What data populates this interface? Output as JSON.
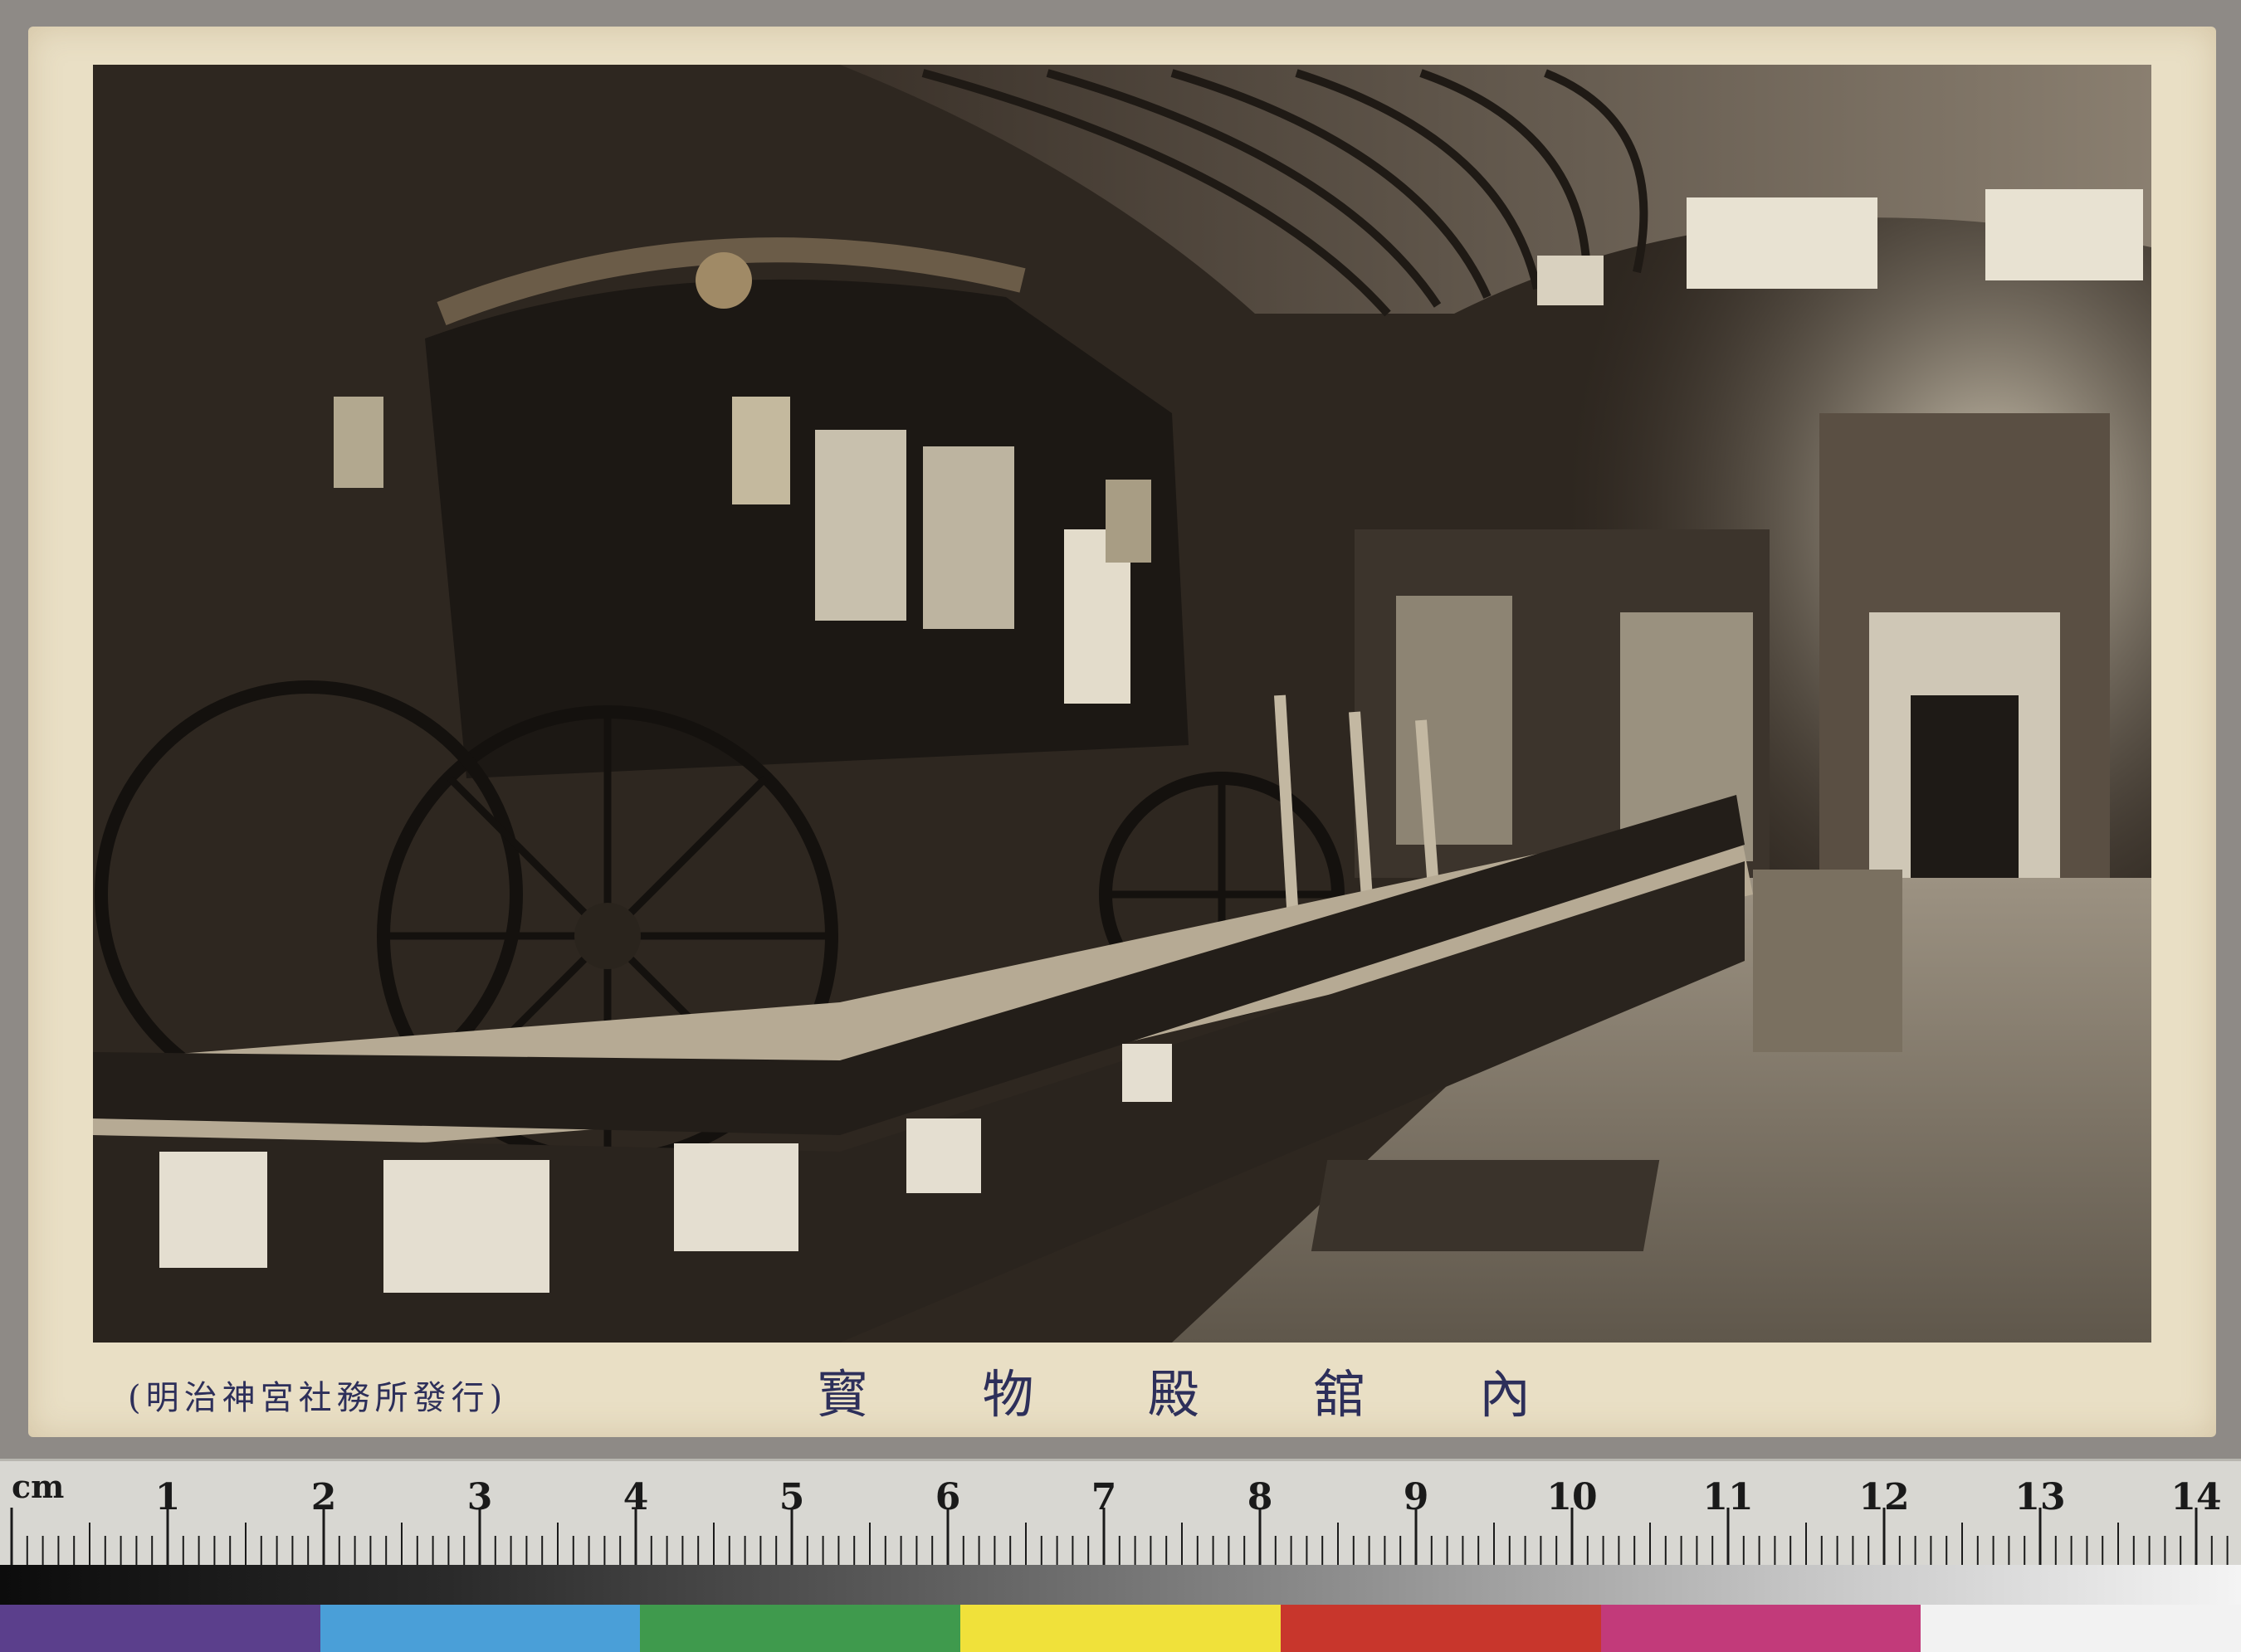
{
  "postcard": {
    "publisher": "(明治神宮社務所發行)",
    "caption_chars": [
      "寳",
      "物",
      "殿",
      "舘",
      "內"
    ]
  },
  "ruler": {
    "unit": "cm",
    "numbers": [
      "1",
      "2",
      "3",
      "4",
      "5",
      "6",
      "7",
      "8",
      "9",
      "10",
      "11",
      "12",
      "13",
      "14"
    ]
  },
  "color_patches": [
    "#5b3f8c",
    "#4a9fd8",
    "#3f9a4d",
    "#f0e13a",
    "#c8362c",
    "#c23a7a",
    "#f2f2f2"
  ]
}
